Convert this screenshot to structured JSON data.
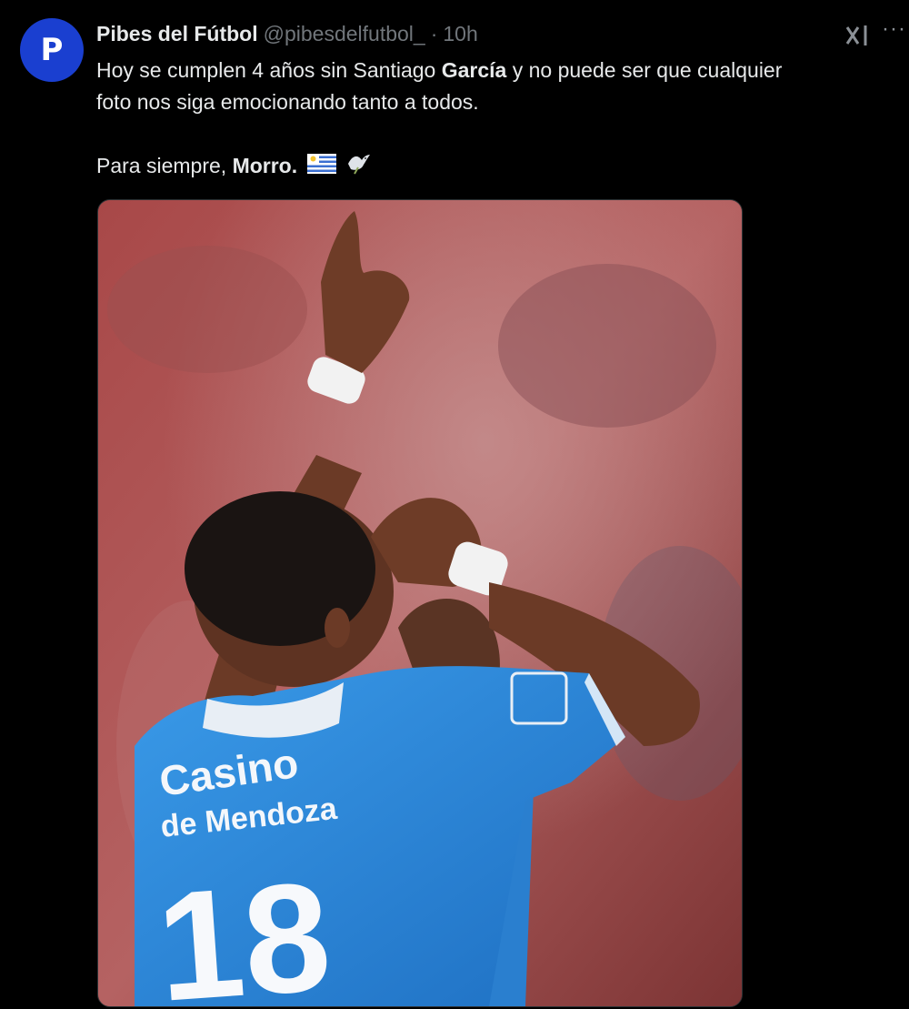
{
  "tweet": {
    "avatar_letter": "P",
    "author_name": "Pibes del Fútbol",
    "author_handle": "@pibesdelfutbol_",
    "separator": "·",
    "time": "10h",
    "text_line1_a": "Hoy se cumplen 4 años sin Santiago ",
    "text_line1_bold": "García",
    "text_line1_b": " y no puede ser que cualquier",
    "text_line2": "foto nos siga emocionando tanto a todos.",
    "text_line3_a": "Para siempre, ",
    "text_line3_bold": "Morro.",
    "emojis": [
      "flag-uruguay-icon",
      "dove-icon"
    ],
    "more_label": "···",
    "media": {
      "sponsor_line1": "Casino",
      "sponsor_line2": "de Mendoza",
      "jersey_number": "18",
      "colors": {
        "jersey": "#2d8ad8",
        "background": "#9a3c3c",
        "skin": "#6b3a26"
      }
    }
  }
}
